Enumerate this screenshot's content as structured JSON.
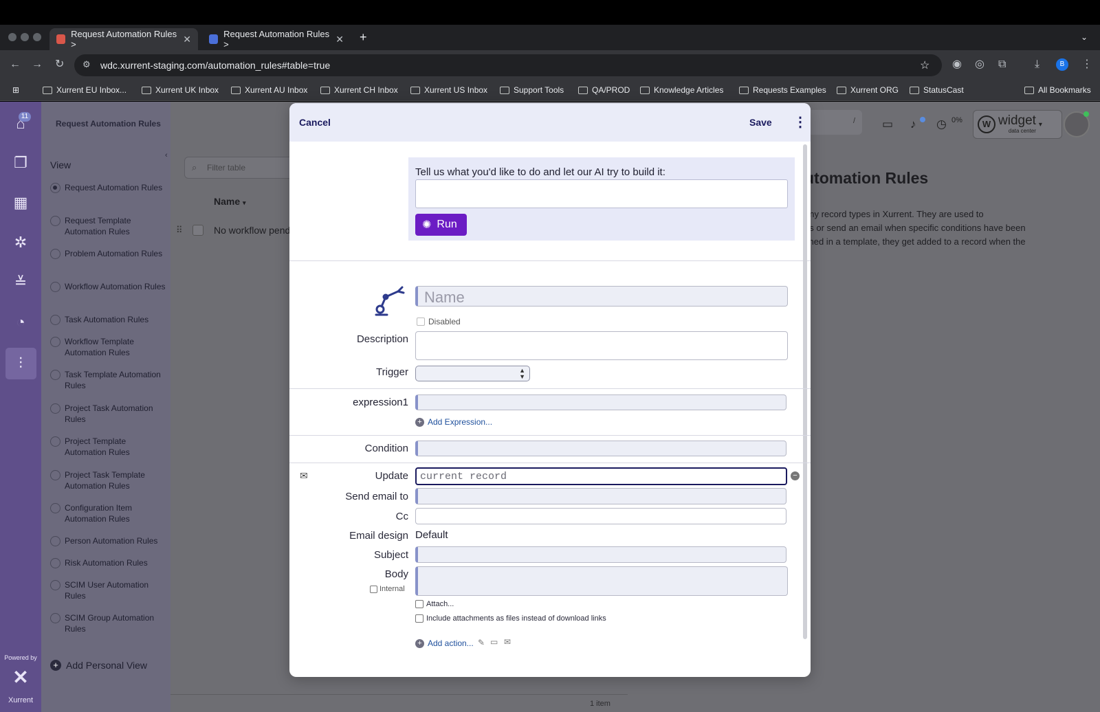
{
  "browser": {
    "tabs": [
      {
        "label": "Request Automation Rules > ",
        "active": true
      },
      {
        "label": "Request Automation Rules > ",
        "active": false
      }
    ],
    "new_tab": "+",
    "url": "wdc.xurrent-staging.com/automation_rules#table=true",
    "profile_initial": "B",
    "bookmarks": [
      "Xurrent EU Inbox...",
      "Xurrent UK Inbox",
      "Xurrent AU Inbox",
      "Xurrent CH Inbox",
      "Xurrent US Inbox",
      "Support Tools",
      "QA/PROD",
      "Knowledge Articles",
      "Requests Examples",
      "Xurrent ORG",
      "StatusCast"
    ],
    "all_bookmarks": "All Bookmarks"
  },
  "rail": {
    "inbox_badge": "11",
    "powered_by": "Powered by",
    "brand": "Xurrent"
  },
  "sidebar": {
    "title": "Request Automation Rules",
    "view_label": "View",
    "items": [
      {
        "label": "Request Automation Rules",
        "selected": true
      },
      {
        "label": "Request Template Automation Rules",
        "selected": false
      },
      {
        "label": "Problem Automation Rules",
        "selected": false
      },
      {
        "label": "Workflow Automation Rules",
        "selected": false
      },
      {
        "label": "Task Automation Rules",
        "selected": false
      },
      {
        "label": "Workflow Template Automation Rules",
        "selected": false
      },
      {
        "label": "Task Template Automation Rules",
        "selected": false
      },
      {
        "label": "Project Task Automation Rules",
        "selected": false
      },
      {
        "label": "Project Template Automation Rules",
        "selected": false
      },
      {
        "label": "Project Task Template Automation Rules",
        "selected": false
      },
      {
        "label": "Configuration Item Automation Rules",
        "selected": false
      },
      {
        "label": "Person Automation Rules",
        "selected": false
      },
      {
        "label": "Risk Automation Rules",
        "selected": false
      },
      {
        "label": "SCIM User Automation Rules",
        "selected": false
      },
      {
        "label": "SCIM Group Automation Rules",
        "selected": false
      }
    ],
    "add_view": "Add Personal View"
  },
  "list": {
    "filter_placeholder": "Filter table",
    "column_name": "Name",
    "row_text": "No workflow pend",
    "count": "1 item"
  },
  "right": {
    "title": "utomation Rules",
    "para": [
      "any record types in Xurrent. They are used to",
      "ds or send an email when specific conditions have been",
      "fined in a template, they get added to a record when the"
    ],
    "slash_hint": "/",
    "progress": "0%",
    "widget_name": "widget",
    "widget_sub": "data center"
  },
  "modal": {
    "cancel": "Cancel",
    "save": "Save",
    "ai_prompt": "Tell us what you'd like to do and let our AI try to build it:",
    "run": "Run",
    "name_placeholder": "Name",
    "disabled_label": "Disabled",
    "description_label": "Description",
    "trigger_label": "Trigger",
    "expression_label": "expression1",
    "add_expression": "Add Expression...",
    "condition_label": "Condition",
    "update_label": "Update",
    "update_placeholder": "current record",
    "send_email_label": "Send email to",
    "cc_label": "Cc",
    "email_design_label": "Email design",
    "email_design_value": "Default",
    "subject_label": "Subject",
    "body_label": "Body",
    "internal_label": "Internal",
    "attach_label": "Attach...",
    "include_attachments_label": "Include attachments as files instead of download links",
    "add_action": "Add action..."
  },
  "colors": {
    "accent_purple": "#6b1cc4",
    "rail": "#5f4f8a",
    "link": "#1e4f9c"
  }
}
